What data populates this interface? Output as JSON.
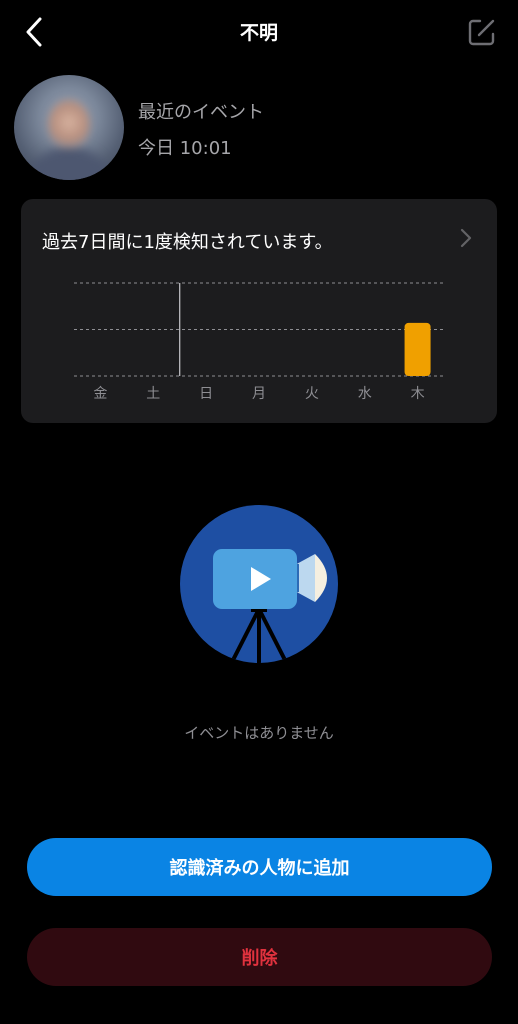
{
  "header": {
    "title": "不明",
    "back_icon": "chevron-left-icon",
    "edit_icon": "edit-icon"
  },
  "profile": {
    "recent_label": "最近のイベント",
    "recent_time": "今日 10:01"
  },
  "detection": {
    "summary": "過去7日間に1度検知されています。",
    "chevron_icon": "chevron-right-icon"
  },
  "chart_data": {
    "type": "bar",
    "categories": [
      "金",
      "土",
      "日",
      "月",
      "火",
      "水",
      "木"
    ],
    "values": [
      0,
      0,
      0,
      0,
      0,
      0,
      1
    ],
    "ylim": [
      0,
      1.75
    ],
    "grid": true,
    "bar_color": "#f0a000",
    "highlight_divider_after": "土"
  },
  "empty_state": {
    "icon": "video-camera-icon",
    "text": "イベントはありません"
  },
  "actions": {
    "add_label": "認識済みの人物に追加",
    "delete_label": "削除"
  },
  "colors": {
    "primary": "#0a84e4",
    "danger_text": "#e0323e",
    "danger_bg": "#300a10",
    "card_bg": "#1c1c1e"
  }
}
